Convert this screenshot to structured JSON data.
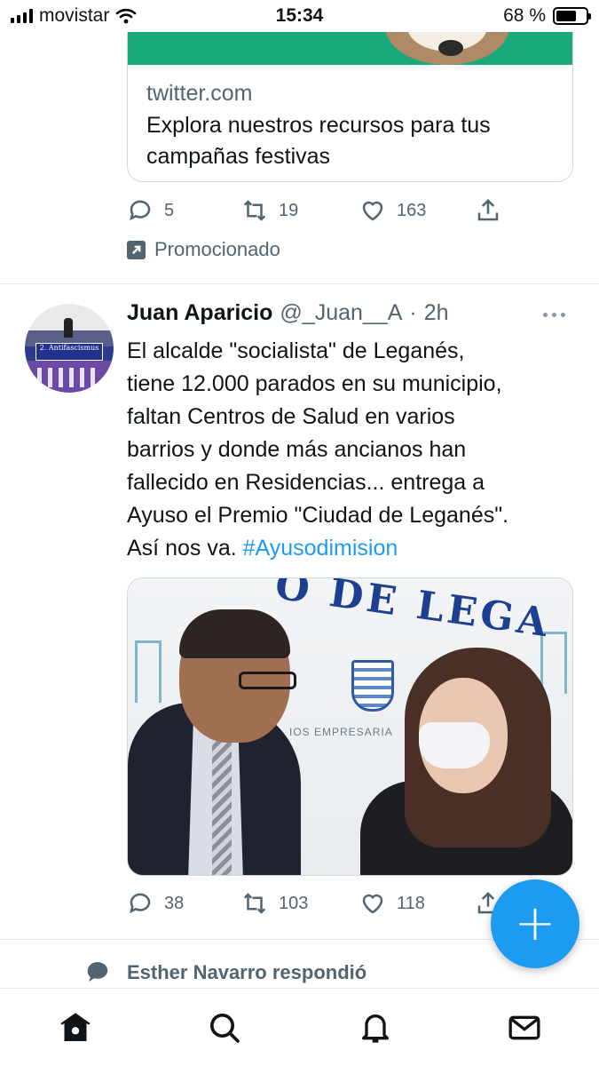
{
  "status_bar": {
    "carrier": "movistar",
    "time": "15:34",
    "battery": "68 %",
    "battery_level": 0.68
  },
  "promoted_tweet": {
    "card_domain": "twitter.com",
    "card_title": "Explora nuestros recursos para tus campañas festivas",
    "replies": "5",
    "retweets": "19",
    "likes": "163",
    "promoted_label": "Promocionado"
  },
  "tweet": {
    "name": "Juan Aparicio",
    "handle": "@_Juan__A",
    "separator": "·",
    "time": "2h",
    "avatar_banner_text": "2. Antifascismus",
    "text": "El alcalde \"socialista\" de Leganés,\ntiene 12.000 parados en su municipio,\nfaltan Centros de Salud en varios\nbarrios y donde más ancianos han\nfallecido en Residencias... entrega a\nAyuso el Premio \"Ciudad de Leganés\".\nAsí nos va. ",
    "hashtag": "#Ayusodimision",
    "photo_banner_text": "O DE LEGA",
    "photo_sub_text": "IOS EMPRESARIA",
    "replies": "38",
    "retweets": "103",
    "likes": "118"
  },
  "reply_notice": {
    "text": "Esther Navarro respondió"
  },
  "fab": {
    "label": "+"
  },
  "bottom_nav": {
    "items": [
      "home-icon",
      "search-icon",
      "bell-icon",
      "mail-icon"
    ]
  },
  "colors": {
    "accent": "#1d9bf0",
    "secondary_text": "#536471",
    "border": "#cfd9de"
  }
}
